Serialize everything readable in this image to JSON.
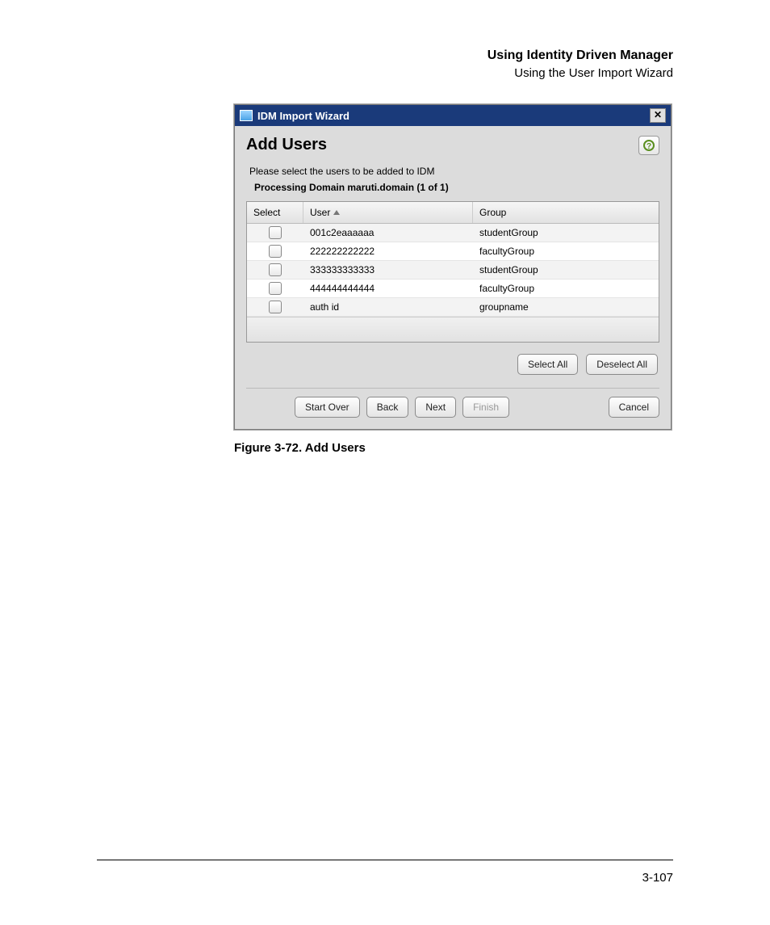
{
  "header": {
    "chapter": "Using Identity Driven Manager",
    "section": "Using the User Import Wizard"
  },
  "dialog": {
    "window_title": "IDM Import Wizard",
    "heading": "Add Users",
    "instruction": "Please select the users to be added to IDM",
    "domain_line": "Processing Domain maruti.domain (1 of 1)",
    "columns": {
      "select": "Select",
      "user": "User",
      "group": "Group"
    },
    "rows": [
      {
        "user": "001c2eaaaaaa",
        "group": "studentGroup"
      },
      {
        "user": "222222222222",
        "group": "facultyGroup"
      },
      {
        "user": "333333333333",
        "group": "studentGroup"
      },
      {
        "user": "444444444444",
        "group": "facultyGroup"
      },
      {
        "user": "auth id",
        "group": "groupname"
      }
    ],
    "buttons": {
      "select_all": "Select All",
      "deselect_all": "Deselect All",
      "start_over": "Start Over",
      "back": "Back",
      "next": "Next",
      "finish": "Finish",
      "cancel": "Cancel"
    }
  },
  "figure_caption": "Figure 3-72. Add Users",
  "page_number": "3-107"
}
